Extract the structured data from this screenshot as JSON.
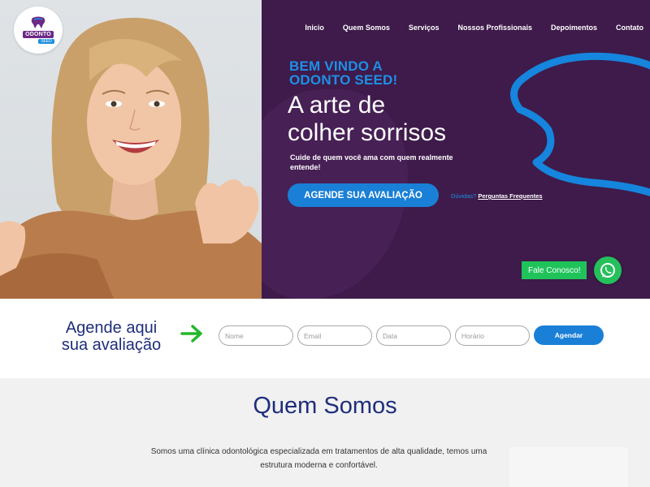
{
  "logo": {
    "name": "ODONTO",
    "sub": "SEED"
  },
  "nav": {
    "items": [
      "Inicio",
      "Quem Somos",
      "Serviços",
      "Nossos Profissionais",
      "Depoimentos",
      "Contato"
    ]
  },
  "hero": {
    "welcome_line1": "BEM VINDO A",
    "welcome_line2": "ODONTO SEED!",
    "headline_line1": "A arte de",
    "headline_line2": "colher sorrisos",
    "tagline": "Cuide de quem você ama com quem realmente entende!",
    "cta_label": "AGENDE SUA AVALIAÇÃO",
    "faq_question": "Dúvidas?",
    "faq_link": "Perguntas Frequentes"
  },
  "contact": {
    "fale_label": "Fale Conosco!"
  },
  "booking": {
    "title_line1": "Agende aqui",
    "title_line2": "sua avaliação",
    "fields": {
      "nome_placeholder": "Nome",
      "email_placeholder": "Email",
      "data_placeholder": "Data",
      "horario_placeholder": "Horário"
    },
    "submit_label": "Agendar"
  },
  "about": {
    "title": "Quem Somos",
    "text": "Somos uma clínica odontológica especializada em tratamentos de alta qualidade, temos uma estrutura moderna e confortável."
  },
  "colors": {
    "hero_bg": "#3e1b4a",
    "accent_blue": "#1a7fd6",
    "title_navy": "#1f2e7a",
    "whatsapp_green": "#1fc35a"
  },
  "icons": [
    "tooth-logo-icon",
    "arrow-right-icon",
    "whatsapp-icon"
  ]
}
